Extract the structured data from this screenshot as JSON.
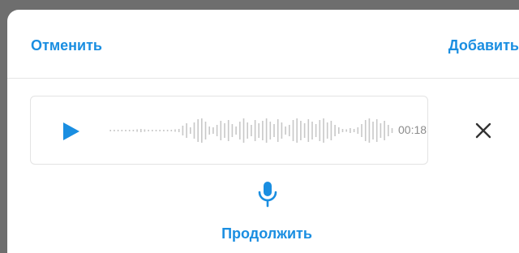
{
  "header": {
    "cancel_label": "Отменить",
    "add_label": "Добавить"
  },
  "player": {
    "duration": "00:18",
    "play_icon": "play-icon",
    "remove_icon": "close-icon"
  },
  "footer": {
    "mic_icon": "microphone-icon",
    "continue_label": "Продолжить"
  },
  "colors": {
    "accent": "#1a8ee1",
    "waveform": "#c8c8c8",
    "icon_dark": "#333333"
  }
}
